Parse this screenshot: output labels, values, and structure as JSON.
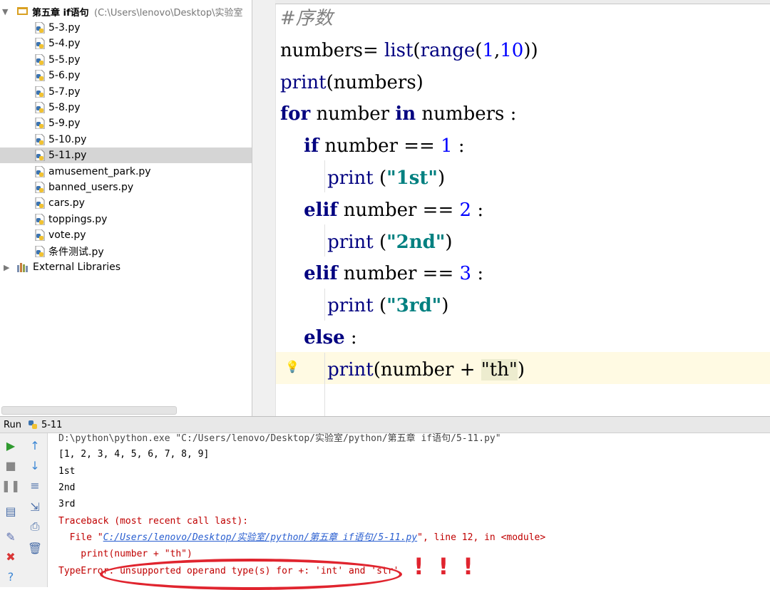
{
  "project": {
    "name": "第五章 if语句",
    "path": "(C:\\Users\\lenovo\\Desktop\\实验室",
    "files": [
      "5-3.py",
      "5-4.py",
      "5-5.py",
      "5-6.py",
      "5-7.py",
      "5-8.py",
      "5-9.py",
      "5-10.py",
      "5-11.py",
      "amusement_park.py",
      "banned_users.py",
      "cars.py",
      "toppings.py",
      "vote.py",
      "条件测试.py"
    ],
    "selected_file": "5-11.py",
    "external_libraries": "External Libraries"
  },
  "editor": {
    "lines": [
      {
        "t": "cmt",
        "text": "#序数"
      },
      {
        "t": "code",
        "parts": [
          [
            "",
            "numbers= "
          ],
          [
            "bi",
            "list"
          ],
          [
            "",
            "("
          ],
          [
            "bi",
            "range"
          ],
          [
            "",
            "("
          ],
          [
            "num",
            "1"
          ],
          [
            "",
            ","
          ],
          [
            "num",
            "10"
          ],
          [
            "",
            "))"
          ]
        ]
      },
      {
        "t": "code",
        "parts": [
          [
            "bi",
            "print"
          ],
          [
            "",
            "(numbers)"
          ]
        ]
      },
      {
        "t": "code",
        "parts": [
          [
            "kw",
            "for"
          ],
          [
            "",
            " number "
          ],
          [
            "kw",
            "in"
          ],
          [
            "",
            " numbers :"
          ]
        ]
      },
      {
        "t": "code",
        "parts": [
          [
            "",
            "    "
          ],
          [
            "kw",
            "if"
          ],
          [
            "",
            " number == "
          ],
          [
            "num",
            "1"
          ],
          [
            "",
            " :"
          ]
        ]
      },
      {
        "t": "code",
        "parts": [
          [
            "",
            "        "
          ],
          [
            "bi",
            "print"
          ],
          [
            "",
            " ("
          ],
          [
            "str",
            "\"1st\""
          ],
          [
            "",
            ")"
          ]
        ]
      },
      {
        "t": "code",
        "parts": [
          [
            "",
            "    "
          ],
          [
            "kw",
            "elif"
          ],
          [
            "",
            " number == "
          ],
          [
            "num",
            "2"
          ],
          [
            "",
            " :"
          ]
        ]
      },
      {
        "t": "code",
        "parts": [
          [
            "",
            "        "
          ],
          [
            "bi",
            "print"
          ],
          [
            "",
            " ("
          ],
          [
            "str",
            "\"2nd\""
          ],
          [
            "",
            ")"
          ]
        ]
      },
      {
        "t": "code",
        "parts": [
          [
            "",
            "    "
          ],
          [
            "kw",
            "elif"
          ],
          [
            "",
            " number == "
          ],
          [
            "num",
            "3"
          ],
          [
            "",
            " :"
          ]
        ]
      },
      {
        "t": "code",
        "parts": [
          [
            "",
            "        "
          ],
          [
            "bi",
            "print"
          ],
          [
            "",
            " ("
          ],
          [
            "str",
            "\"3rd\""
          ],
          [
            "",
            ")"
          ]
        ]
      },
      {
        "t": "code",
        "parts": [
          [
            "",
            "    "
          ],
          [
            "kw",
            "else"
          ],
          [
            "",
            " :"
          ]
        ]
      },
      {
        "t": "code",
        "parts": [
          [
            "",
            "        "
          ],
          [
            "bi",
            "print"
          ],
          [
            "",
            "(number + "
          ],
          [
            "strhl",
            "\"th\""
          ],
          [
            "",
            ")"
          ]
        ]
      }
    ]
  },
  "run": {
    "label": "Run",
    "config": "5-11"
  },
  "console": {
    "command": "D:\\python\\python.exe \"C:/Users/lenovo/Desktop/实验室/python/第五章 if语句/5-11.py\"",
    "output": [
      "[1, 2, 3, 4, 5, 6, 7, 8, 9]",
      "1st",
      "2nd",
      "3rd"
    ],
    "traceback_header": "Traceback (most recent call last):",
    "file_prefix": "  File \"",
    "file_link": "C:/Users/lenovo/Desktop/实验室/python/第五章 if语句/5-11.py",
    "file_suffix": "\", line 12, in <module>",
    "code_line": "    print(number + \"th\")",
    "error": "TypeError: unsupported operand type(s) for +: 'int' and 'str'"
  },
  "annotation": {
    "marks": "!!!",
    "color": "#e0242e"
  }
}
